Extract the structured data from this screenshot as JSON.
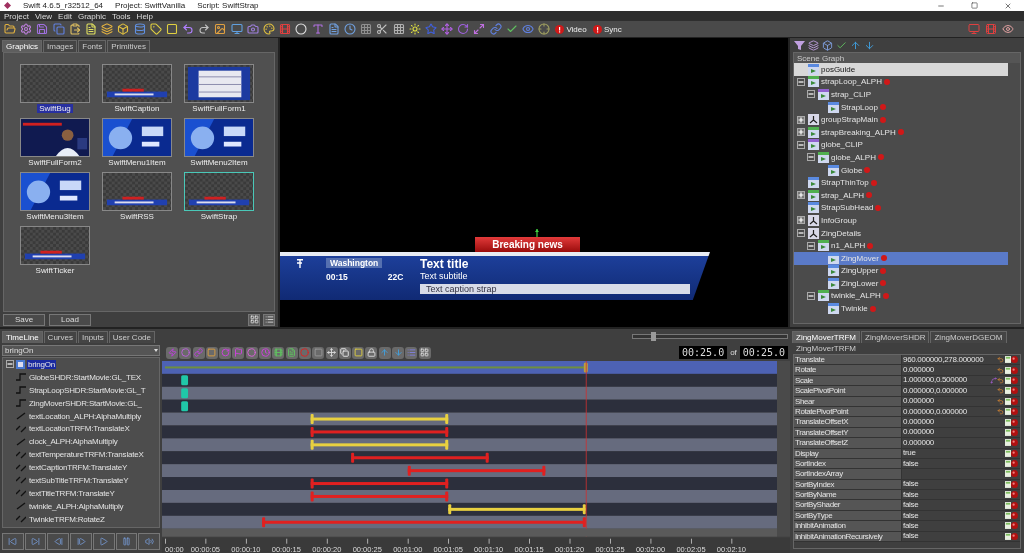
{
  "window": {
    "title": "Swift 4.6.5_r32512_64",
    "project": "Project: SwiftVanilla",
    "script": "Script: SwiftStrap"
  },
  "menu": [
    "Project",
    "View",
    "Edit",
    "Graphic",
    "Tools",
    "Help"
  ],
  "toolbar_toggles": [
    {
      "label": "Video"
    },
    {
      "label": "Sync"
    }
  ],
  "library": {
    "tabs": [
      {
        "label": "Graphics",
        "selected": true
      },
      {
        "label": "Images",
        "selected": false
      },
      {
        "label": "Fonts",
        "selected": false
      },
      {
        "label": "Primitives",
        "selected": false
      }
    ],
    "items": [
      {
        "name": "SwiftBug",
        "kind": "blank",
        "selected": true,
        "current": false
      },
      {
        "name": "SwiftCaption",
        "kind": "strap",
        "selected": false,
        "current": false
      },
      {
        "name": "SwiftFullForm1",
        "kind": "table",
        "selected": false,
        "current": false
      },
      {
        "name": "SwiftFullForm2",
        "kind": "figure",
        "selected": false,
        "current": false
      },
      {
        "name": "SwiftMenu1Item",
        "kind": "blue",
        "selected": false,
        "current": false
      },
      {
        "name": "SwiftMenu2Item",
        "kind": "blue",
        "selected": false,
        "current": false
      },
      {
        "name": "SwiftMenu3Item",
        "kind": "blue",
        "selected": false,
        "current": false
      },
      {
        "name": "SwiftRSS",
        "kind": "strap",
        "selected": false,
        "current": false
      },
      {
        "name": "SwiftStrap",
        "kind": "strap",
        "selected": false,
        "current": true
      },
      {
        "name": "SwiftTicker",
        "kind": "strap",
        "selected": false,
        "current": false
      }
    ],
    "buttons": [
      "Save",
      "Load"
    ]
  },
  "preview": {
    "banner": "Breaking news",
    "location": "Washington",
    "title": "Text title",
    "subtitle": "Text subtitle",
    "time": "00:15",
    "temperature": "22C",
    "caption": "Text caption strap"
  },
  "scene_graph": {
    "title": "Scene Graph",
    "nodes": [
      {
        "name": "posGuide",
        "kind": "shader",
        "flagged": false,
        "selected": false,
        "hovered": true
      },
      {
        "name": "strapLoop_ALPH",
        "kind": "alpha",
        "flagged": true,
        "selected": false,
        "expanded": true,
        "children": [
          {
            "name": "strap_CLIP",
            "kind": "clip",
            "flagged": false,
            "selected": false,
            "expanded": true,
            "children": [
              {
                "name": "StrapLoop",
                "kind": "shader",
                "flagged": true,
                "selected": false
              }
            ]
          }
        ]
      },
      {
        "name": "groupStrapMain",
        "kind": "group",
        "flagged": true,
        "selected": false,
        "expanded": false
      },
      {
        "name": "strapBreaking_ALPH",
        "kind": "alpha",
        "flagged": true,
        "selected": false,
        "expanded": false
      },
      {
        "name": "globe_CLIP",
        "kind": "clip",
        "flagged": false,
        "selected": false,
        "expanded": true,
        "children": [
          {
            "name": "globe_ALPH",
            "kind": "alpha",
            "flagged": true,
            "selected": false,
            "expanded": true,
            "children": [
              {
                "name": "Globe",
                "kind": "shader",
                "flagged": true,
                "selected": false
              }
            ]
          }
        ]
      },
      {
        "name": "StrapThinTop",
        "kind": "shader",
        "flagged": true,
        "selected": false
      },
      {
        "name": "strap_ALPH",
        "kind": "alpha",
        "flagged": true,
        "selected": false,
        "expanded": false
      },
      {
        "name": "StrapSubHead",
        "kind": "shader",
        "flagged": true,
        "selected": false
      },
      {
        "name": "InfoGroup",
        "kind": "group",
        "flagged": false,
        "selected": false,
        "expanded": false
      },
      {
        "name": "ZingDetails",
        "kind": "group",
        "flagged": false,
        "selected": false,
        "expanded": true,
        "children": [
          {
            "name": "n1_ALPH",
            "kind": "alpha",
            "flagged": true,
            "selected": false,
            "expanded": true,
            "children": [
              {
                "name": "ZingMover",
                "kind": "shader",
                "flagged": true,
                "selected": true
              },
              {
                "name": "ZingUpper",
                "kind": "shader",
                "flagged": true,
                "selected": false
              },
              {
                "name": "ZingLower",
                "kind": "shader",
                "flagged": true,
                "selected": false
              }
            ]
          },
          {
            "name": "twinkle_ALPH",
            "kind": "alpha",
            "flagged": true,
            "selected": false,
            "expanded": true,
            "children": [
              {
                "name": "Twinkle",
                "kind": "shader",
                "flagged": true,
                "selected": false
              }
            ]
          }
        ]
      }
    ]
  },
  "timeline": {
    "tabs": [
      {
        "label": "TimeLine",
        "selected": true
      },
      {
        "label": "Curves",
        "selected": false
      },
      {
        "label": "Inputs",
        "selected": false
      },
      {
        "label": "User Code",
        "selected": false
      }
    ],
    "zoom": {
      "level": 0.12
    },
    "animation": "bringOn",
    "time": "00:25.0",
    "of": "of",
    "duration": "00:25.0",
    "tracks": [
      {
        "label": "bringOn",
        "kind": "root",
        "selected": true,
        "expanded": true,
        "children": [
          {
            "label": "GlobeSHDR:StartMovie:GL_TEX",
            "kind": "step",
            "selected": false
          },
          {
            "label": "StrapLoopSHDR:StartMovie:GL_T",
            "kind": "step",
            "selected": false
          },
          {
            "label": "ZingMoverSHDR:StartMovie:GL_",
            "kind": "step",
            "selected": false
          },
          {
            "label": "textLocation_ALPH:AlphaMultiply",
            "kind": "alpha",
            "selected": false
          },
          {
            "label": "textLocationTRFM:TranslateX",
            "kind": "transform",
            "selected": false
          },
          {
            "label": "clock_ALPH:AlphaMultiply",
            "kind": "alpha",
            "selected": false
          },
          {
            "label": "textTemperatureTRFM:TranslateX",
            "kind": "transform",
            "selected": false
          },
          {
            "label": "textCaptionTRFM:TranslateY",
            "kind": "transform",
            "selected": false
          },
          {
            "label": "textSubTitleTRFM:TranslateY",
            "kind": "transform",
            "selected": false
          },
          {
            "label": "textTitleTRFM:TranslateY",
            "kind": "transform",
            "selected": false
          },
          {
            "label": "twinkle_ALPH:AlphaMultiply",
            "kind": "alpha",
            "selected": false
          },
          {
            "label": "TwinkleTRFM:RotateZ",
            "kind": "transform",
            "selected": false
          }
        ]
      }
    ],
    "ruler": [
      "00:00",
      "00:00:05",
      "00:00:10",
      "00:00:15",
      "00:00:20",
      "00:00:25",
      "00:01:00",
      "00:01:05",
      "00:01:10",
      "00:01:15",
      "00:01:20",
      "00:01:25",
      "00:02:00",
      "00:02:05",
      "00:02:10"
    ]
  },
  "properties": {
    "tabs": [
      {
        "label": "ZingMoverTRFM",
        "selected": true
      },
      {
        "label": "ZingMoverSHDR",
        "selected": false
      },
      {
        "label": "ZingMoverDGEOM",
        "selected": false
      }
    ],
    "header": "ZingMoverTRFM",
    "rows": [
      {
        "name": "Translate",
        "value": "960.000000,278.000000",
        "resettable": true,
        "curve": false
      },
      {
        "name": "Rotate",
        "value": "0.000000",
        "resettable": true,
        "curve": false
      },
      {
        "name": "Scale",
        "value": "1.000000,0.500000",
        "resettable": true,
        "curve": true
      },
      {
        "name": "ScalePivotPoint",
        "value": "0.000000,0.000000",
        "resettable": true,
        "curve": false
      },
      {
        "name": "Shear",
        "value": "0.000000",
        "resettable": true,
        "curve": false
      },
      {
        "name": "RotatePivotPoint",
        "value": "0.000000,0.000000",
        "resettable": true,
        "curve": false
      },
      {
        "name": "TranslateOffsetX",
        "value": "0.000000",
        "resettable": false,
        "curve": false
      },
      {
        "name": "TranslateOffsetY",
        "value": "0.000000",
        "resettable": false,
        "curve": false
      },
      {
        "name": "TranslateOffsetZ",
        "value": "0.000000",
        "resettable": false,
        "curve": false
      },
      {
        "name": "Display",
        "value": "true",
        "resettable": false,
        "curve": false
      },
      {
        "name": "SortIndex",
        "value": "false",
        "resettable": false,
        "curve": false
      },
      {
        "name": "SortIndexArray",
        "resettable": false,
        "curve": false
      },
      {
        "name": "SortByIndex",
        "value": "false",
        "resettable": false,
        "curve": false
      },
      {
        "name": "SortByName",
        "value": "false",
        "resettable": false,
        "curve": false
      },
      {
        "name": "SortByShader",
        "value": "false",
        "resettable": false,
        "curve": false
      },
      {
        "name": "SortByType",
        "value": "false",
        "resettable": false,
        "curve": false
      },
      {
        "name": "InhibitAnimation",
        "value": "false",
        "resettable": false,
        "curve": false
      },
      {
        "name": "InhibitAnimationRecursively",
        "value": "false",
        "resettable": false,
        "curve": false
      }
    ]
  }
}
